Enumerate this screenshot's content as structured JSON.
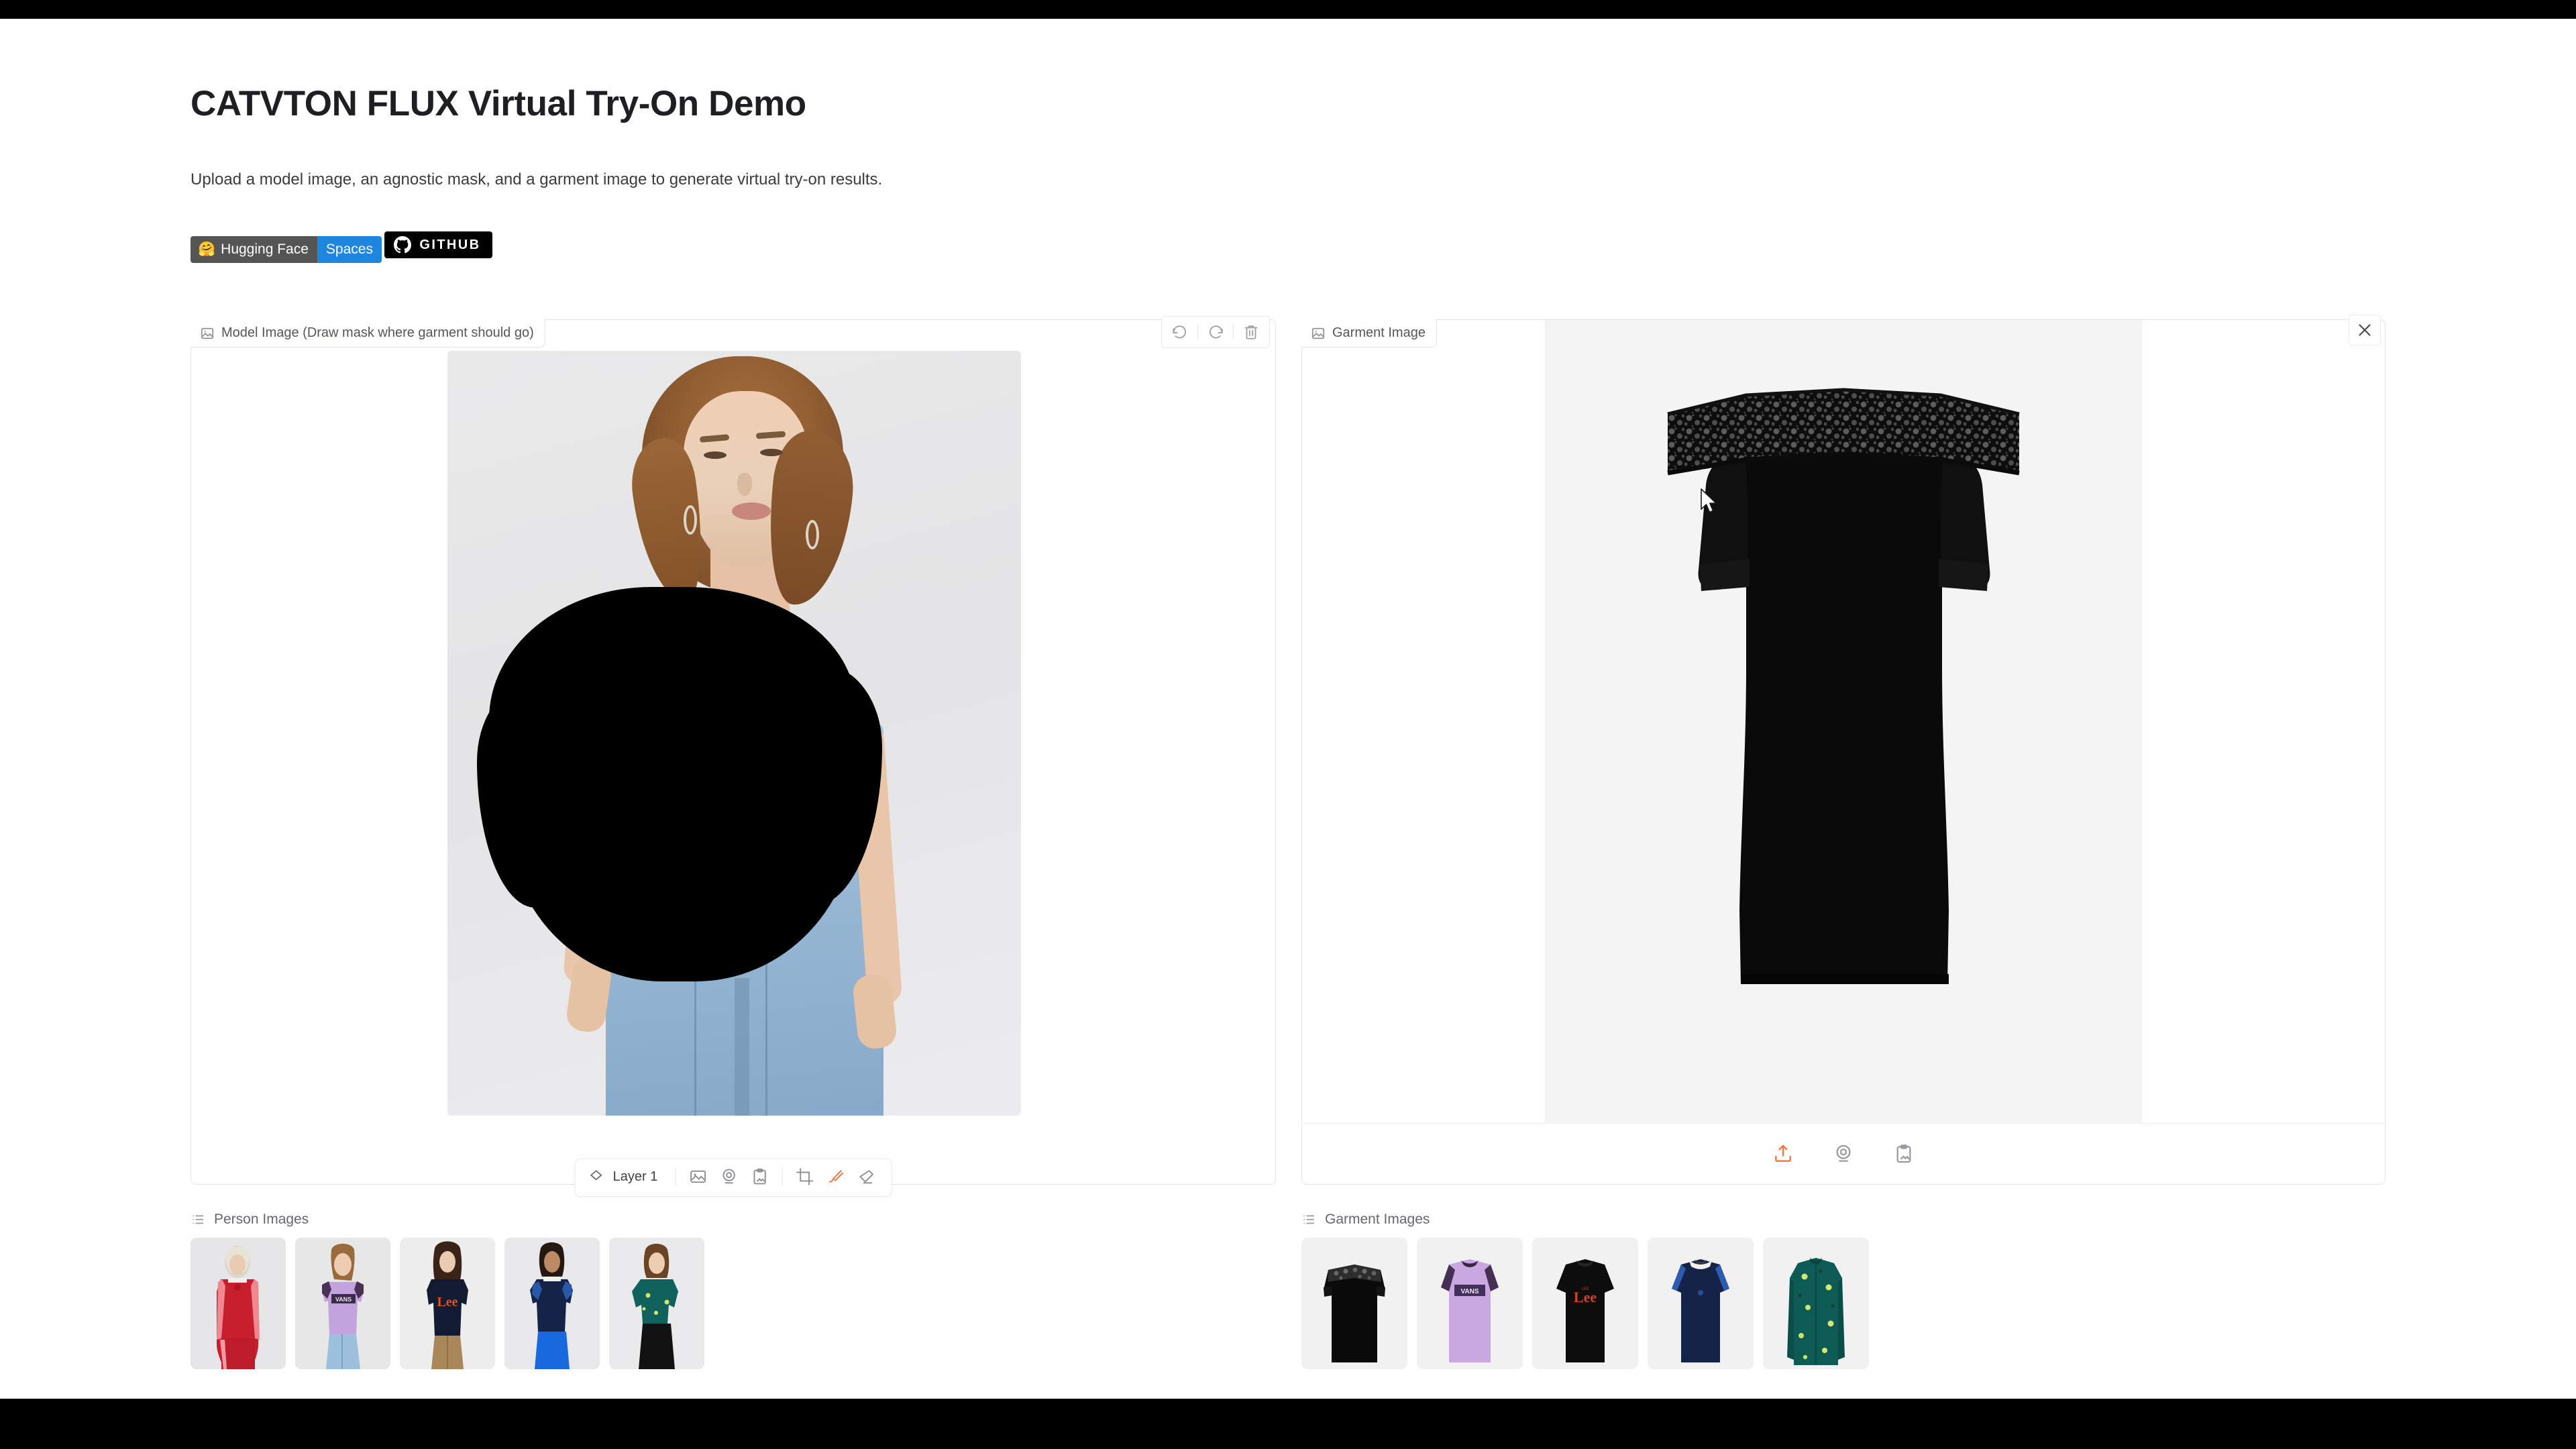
{
  "header": {
    "title": "CATVTON FLUX Virtual Try-On Demo",
    "subtitle": "Upload a model image, an agnostic mask, and a garment image to generate virtual try-on results."
  },
  "badges": {
    "hf_emoji": "🤗",
    "hf_left": "Hugging Face",
    "hf_right": "Spaces",
    "github": "GITHUB",
    "colors": {
      "hf_left_bg": "#555555",
      "hf_right_bg": "#1f86e0",
      "github_bg": "#000000"
    }
  },
  "model_panel": {
    "label": "Model Image (Draw mask where garment should go)",
    "label_icon": "image-icon",
    "tools": [
      {
        "name": "undo-button",
        "icon": "undo-icon"
      },
      {
        "name": "redo-button",
        "icon": "redo-icon"
      },
      {
        "name": "delete-button",
        "icon": "trash-icon"
      }
    ],
    "layer_bar": {
      "layer_icon": "layers-icon",
      "layer_label": "Layer 1",
      "buttons": [
        {
          "name": "upload-image-button",
          "icon": "image-icon"
        },
        {
          "name": "webcam-button",
          "icon": "webcam-icon"
        },
        {
          "name": "paste-clipboard-button",
          "icon": "clipboard-image-icon"
        },
        {
          "name": "crop-button",
          "icon": "crop-icon"
        },
        {
          "name": "brush-button",
          "icon": "brush-icon",
          "active": true
        },
        {
          "name": "eraser-button",
          "icon": "eraser-icon"
        }
      ],
      "active_color": "#f0763a"
    }
  },
  "garment_panel": {
    "label": "Garment Image",
    "label_icon": "image-icon",
    "close_icon": "close-icon",
    "toolbar": [
      {
        "name": "upload-button",
        "icon": "upload-icon",
        "accent": true
      },
      {
        "name": "webcam-button",
        "icon": "webcam-icon"
      },
      {
        "name": "paste-clipboard-button",
        "icon": "clipboard-image-icon"
      }
    ],
    "accent_color": "#f0763a"
  },
  "person_gallery": {
    "label": "Person Images",
    "label_icon": "list-icon",
    "items": [
      {
        "name": "person-thumb-1",
        "alt": "Model in red striped track top and pants"
      },
      {
        "name": "person-thumb-2",
        "alt": "Model in lavender VANS tee and light jeans"
      },
      {
        "name": "person-thumb-3",
        "alt": "Model in navy Lee tee and khaki trousers"
      },
      {
        "name": "person-thumb-4",
        "alt": "Model in navy ringer tee and blue track pants"
      },
      {
        "name": "person-thumb-5",
        "alt": "Model in teal printed blouse and black skirt"
      }
    ]
  },
  "garment_gallery": {
    "label": "Garment Images",
    "label_icon": "list-icon",
    "items": [
      {
        "name": "garment-thumb-1",
        "alt": "Black off-shoulder top with lace yoke"
      },
      {
        "name": "garment-thumb-2",
        "alt": "Lavender VANS colourblock tee"
      },
      {
        "name": "garment-thumb-3",
        "alt": "Black Lee logo tee"
      },
      {
        "name": "garment-thumb-4",
        "alt": "Navy ringer tee with shoulder stripes"
      },
      {
        "name": "garment-thumb-5",
        "alt": "Teal printed long-sleeve blouse"
      }
    ]
  },
  "canvas": {
    "model_image_alt": "Woman with short auburn hair, black mask painted over torso, light blue jeans",
    "garment_image_alt": "Black off-shoulder short-sleeve top with floral lace yoke",
    "mask_color": "#000000"
  }
}
